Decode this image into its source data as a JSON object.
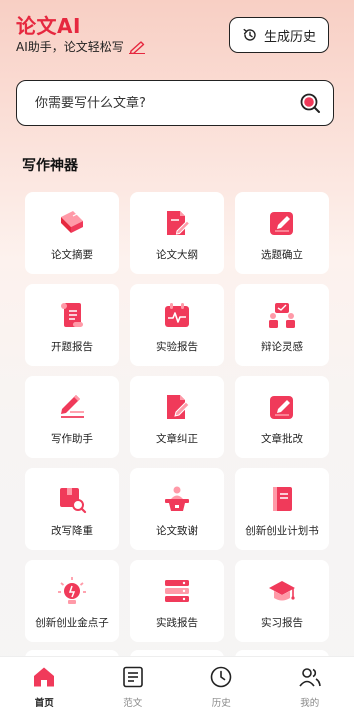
{
  "header": {
    "title": "论文AI",
    "subtitle": "AI助手，论文轻松写",
    "history_button": "生成历史"
  },
  "search": {
    "placeholder": "你需要写什么文章?"
  },
  "section": {
    "title": "写作神器"
  },
  "tools": [
    {
      "label": "论文摘要",
      "icon": "book-icon"
    },
    {
      "label": "论文大纲",
      "icon": "document-edit-icon"
    },
    {
      "label": "选题确立",
      "icon": "pencil-square-icon"
    },
    {
      "label": "开题报告",
      "icon": "scroll-icon"
    },
    {
      "label": "实验报告",
      "icon": "calendar-pulse-icon"
    },
    {
      "label": "辩论灵感",
      "icon": "debate-icon"
    },
    {
      "label": "写作助手",
      "icon": "pen-lines-icon"
    },
    {
      "label": "文章纠正",
      "icon": "document-pencil-icon"
    },
    {
      "label": "文章批改",
      "icon": "pencil-square-icon"
    },
    {
      "label": "改写降重",
      "icon": "box-search-icon"
    },
    {
      "label": "论文致谢",
      "icon": "podium-icon"
    },
    {
      "label": "创新创业计划书",
      "icon": "notebook-icon"
    },
    {
      "label": "创新创业金点子",
      "icon": "lightbulb-icon"
    },
    {
      "label": "实践报告",
      "icon": "stack-icon"
    },
    {
      "label": "实习报告",
      "icon": "graduation-cap-icon"
    }
  ],
  "tabbar": [
    {
      "label": "首页",
      "icon": "home-icon",
      "active": true
    },
    {
      "label": "范文",
      "icon": "document-icon",
      "active": false
    },
    {
      "label": "历史",
      "icon": "clock-icon",
      "active": false
    },
    {
      "label": "我的",
      "icon": "users-icon",
      "active": false
    }
  ],
  "colors": {
    "accent": "#e6283f",
    "icon_primary": "#f03a5a",
    "icon_secondary": "#ff9aa8"
  }
}
